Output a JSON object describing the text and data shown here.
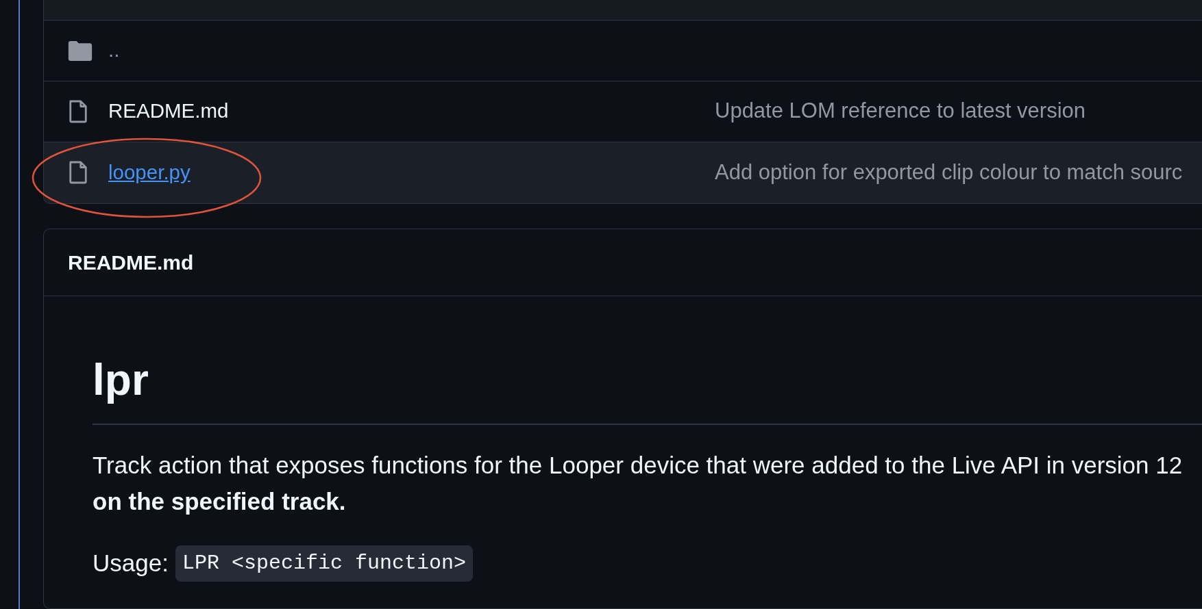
{
  "files": [
    {
      "kind": "folder",
      "name": "..",
      "highlighted": false,
      "link": false
    },
    {
      "kind": "file",
      "name": "README.md",
      "message": "Update LOM reference to latest version",
      "highlighted": false,
      "link": false
    },
    {
      "kind": "file",
      "name": "looper.py",
      "message": "Add option for exported clip colour to match sourc",
      "highlighted": true,
      "link": true
    }
  ],
  "readme": {
    "title": "README.md",
    "heading": "lpr",
    "lines": [
      "Track action that exposes functions for the Looper device that were added to the Live API in version 12",
      "**on the specified track.**"
    ],
    "usage_label": "Usage:",
    "usage_code": "LPR <specific function>"
  }
}
